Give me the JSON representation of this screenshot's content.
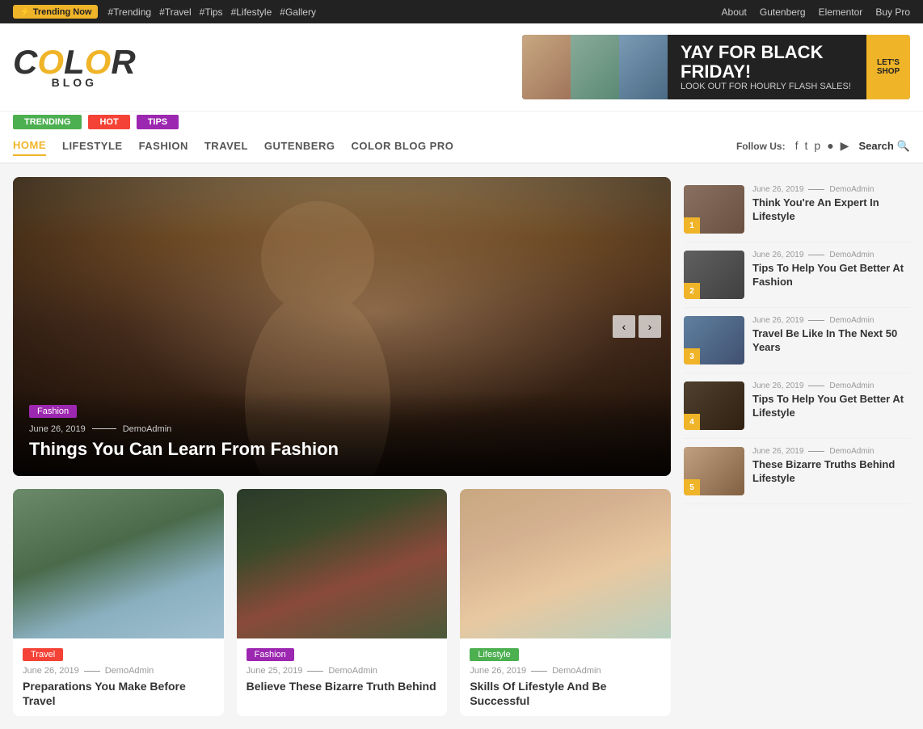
{
  "topbar": {
    "trending_label": "⚡ Trending Now",
    "tags": [
      "#Trending",
      "#Travel",
      "#Tips",
      "#Lifestyle",
      "#Gallery"
    ],
    "right_links": [
      "About",
      "Gutenberg",
      "Elementor",
      "Buy Pro"
    ]
  },
  "header": {
    "logo_text": "COLOR",
    "logo_sub": "BLOG",
    "banner": {
      "headline": "YAY FOR BLACK FRIDAY!",
      "subtext": "LOOK OUT FOR HOURLY FLASH SALES!",
      "cta": "LET'S SHOP"
    }
  },
  "tag_pills": [
    {
      "label": "TRENDING",
      "class": "trending"
    },
    {
      "label": "HOT",
      "class": "hot"
    },
    {
      "label": "TIPS",
      "class": "tips"
    }
  ],
  "nav": {
    "links": [
      "HOME",
      "LIFESTYLE",
      "FASHION",
      "TRAVEL",
      "GUTENBERG",
      "COLOR BLOG PRO"
    ],
    "active": "HOME",
    "follow_label": "Follow Us:",
    "search_label": "Search"
  },
  "hero": {
    "tag": "Fashion",
    "date": "June 26, 2019",
    "author": "DemoAdmin",
    "title": "Things You Can Learn From Fashion"
  },
  "sidebar": {
    "items": [
      {
        "num": "1",
        "date": "June 26, 2019",
        "author": "DemoAdmin",
        "title": "Think You're An Expert In Lifestyle",
        "thumb_class": "sidebar-thumb-1"
      },
      {
        "num": "2",
        "date": "June 26, 2019",
        "author": "DemoAdmin",
        "title": "Tips To Help You Get Better At Fashion",
        "thumb_class": "sidebar-thumb-2"
      },
      {
        "num": "3",
        "date": "June 26, 2019",
        "author": "DemoAdmin",
        "title": "Travel Be Like In The Next 50 Years",
        "thumb_class": "sidebar-thumb-3"
      },
      {
        "num": "4",
        "date": "June 26, 2019",
        "author": "DemoAdmin",
        "title": "Tips To Help You Get Better At Lifestyle",
        "thumb_class": "sidebar-thumb-4"
      },
      {
        "num": "5",
        "date": "June 26, 2019",
        "author": "DemoAdmin",
        "title": "These Bizarre Truths Behind Lifestyle",
        "thumb_class": "sidebar-thumb-5"
      }
    ]
  },
  "cards": [
    {
      "tag": "Travel",
      "tag_class": "travel",
      "img_class": "card-img-travel",
      "date": "June 26, 2019",
      "author": "DemoAdmin",
      "title": "Preparations You Make Before Travel"
    },
    {
      "tag": "Fashion",
      "tag_class": "fashion",
      "img_class": "card-img-fashion",
      "date": "June 25, 2019",
      "author": "DemoAdmin",
      "title": "Believe These Bizarre Truth Behind"
    },
    {
      "tag": "Lifestyle",
      "tag_class": "lifestyle",
      "img_class": "card-img-lifestyle",
      "date": "June 26, 2019",
      "author": "DemoAdmin",
      "title": "Skills Of Lifestyle And Be Successful"
    }
  ]
}
